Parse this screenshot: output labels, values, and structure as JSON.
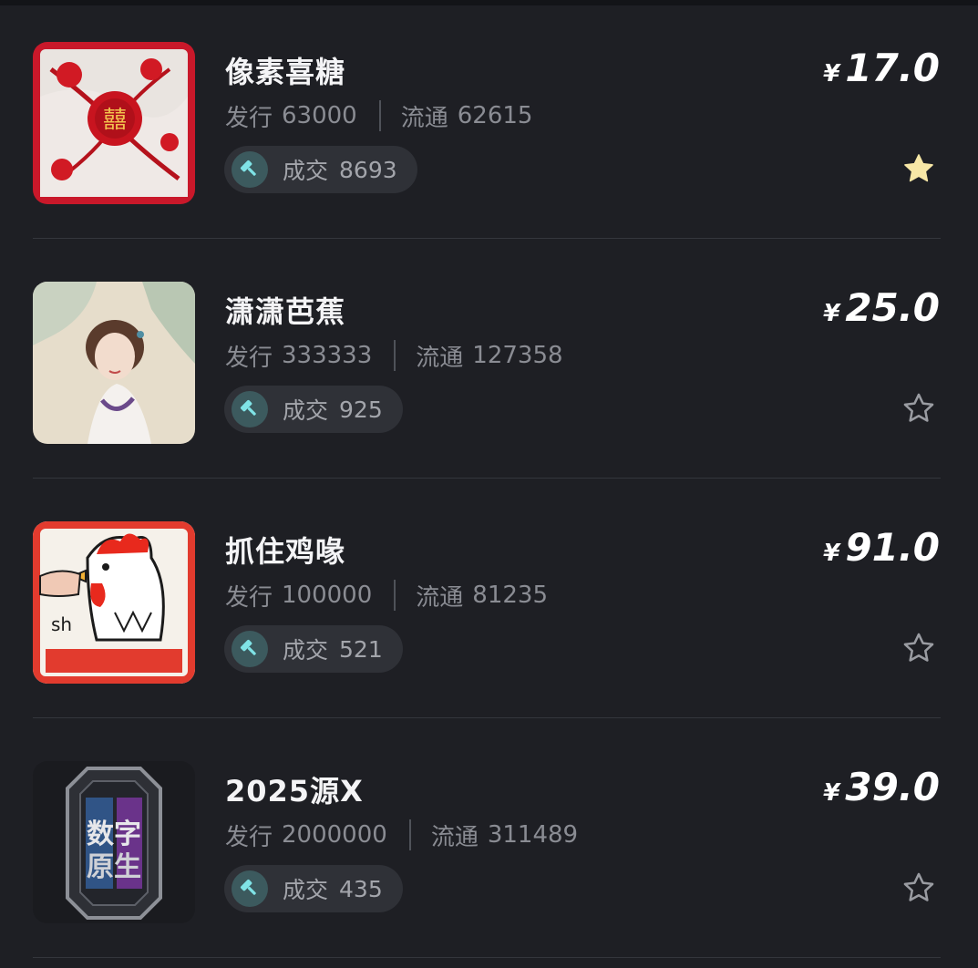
{
  "items": [
    {
      "name": "像素喜糖",
      "issue_label": "发行",
      "issue": "63000",
      "circulation_label": "流通",
      "circulation": "62615",
      "deal_label": "成交",
      "deals": "8693",
      "currency": "¥",
      "price": "17.0",
      "favorited": true
    },
    {
      "name": "潇潇芭蕉",
      "issue_label": "发行",
      "issue": "333333",
      "circulation_label": "流通",
      "circulation": "127358",
      "deal_label": "成交",
      "deals": "925",
      "currency": "¥",
      "price": "25.0",
      "favorited": false
    },
    {
      "name": "抓住鸡喙",
      "issue_label": "发行",
      "issue": "100000",
      "circulation_label": "流通",
      "circulation": "81235",
      "deal_label": "成交",
      "deals": "521",
      "currency": "¥",
      "price": "91.0",
      "favorited": false
    },
    {
      "name": "2025源X",
      "issue_label": "发行",
      "issue": "2000000",
      "circulation_label": "流通",
      "circulation": "311489",
      "deal_label": "成交",
      "deals": "435",
      "currency": "¥",
      "price": "39.0",
      "favorited": false
    }
  ],
  "colors": {
    "background": "#1e1f24",
    "star_filled": "#f7e7a6",
    "star_outline": "#9a9ca2",
    "hammer_bg": "#3c5a5e",
    "hammer_fg": "#7fe3e6"
  },
  "icons": {
    "deal": "gavel-icon",
    "favorite": "star-icon"
  }
}
